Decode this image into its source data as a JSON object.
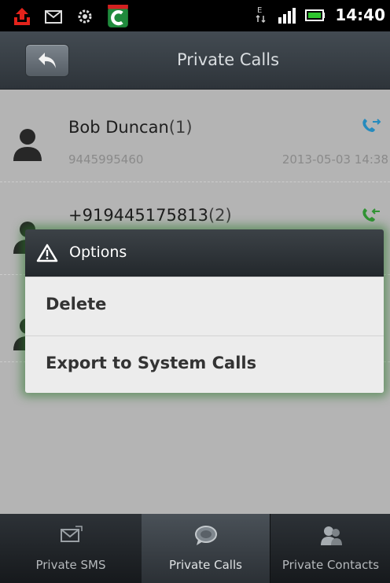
{
  "status_bar": {
    "time": "14:40",
    "icons": [
      "red-upload-icon",
      "message-icon",
      "settings-icon",
      "comodo-app-icon",
      "data-arrows-icon",
      "signal-icon",
      "battery-icon"
    ]
  },
  "header": {
    "title": "Private Calls"
  },
  "calls": [
    {
      "name": "Bob Duncan",
      "count": "(1)",
      "phone": "9445995460",
      "datetime": "2013-05-03 14:38",
      "icon": "outgoing-call-icon",
      "icon_color": "#2b9bd4"
    },
    {
      "name": "+919445175813",
      "count": "(2)",
      "icon": "incoming-call-icon",
      "icon_color": "#37a43a"
    }
  ],
  "dialog": {
    "title": "Options",
    "items": [
      "Delete",
      "Export to System Calls"
    ]
  },
  "tabs": [
    {
      "label": "Private SMS",
      "icon": "sms-icon",
      "active": false
    },
    {
      "label": "Private Calls",
      "icon": "calls-bubble-icon",
      "active": true
    },
    {
      "label": "Private Contacts",
      "icon": "contacts-icon",
      "active": false
    }
  ]
}
